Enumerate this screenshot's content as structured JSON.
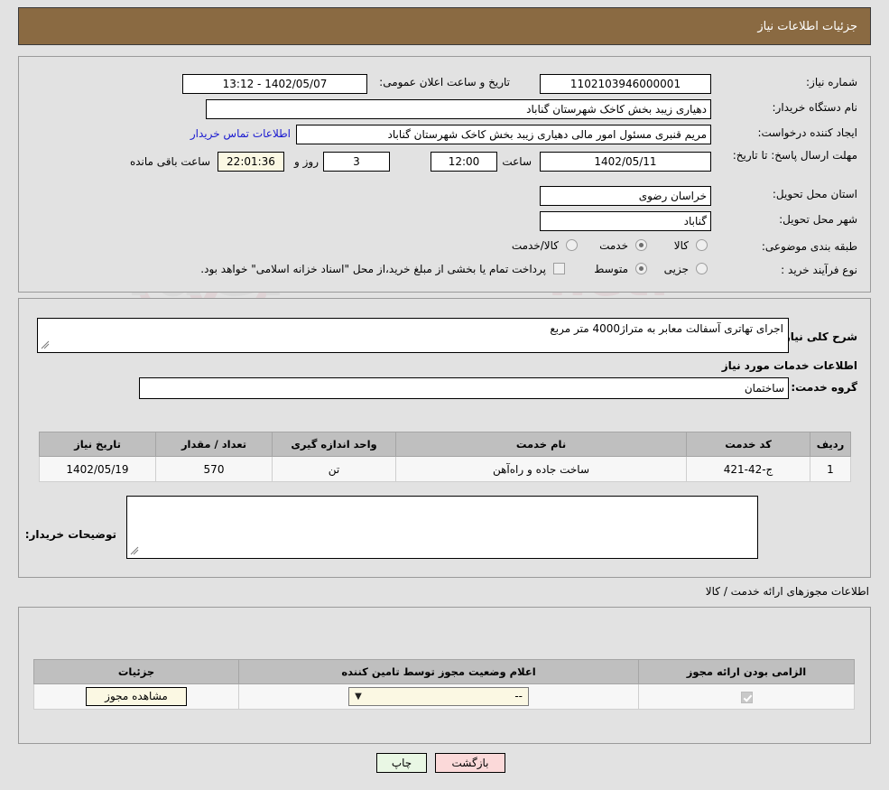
{
  "header": {
    "title": "جزئیات اطلاعات نیاز"
  },
  "watermark": {
    "text": "AnaTender.net"
  },
  "top_form": {
    "need_number": {
      "label": "شماره نیاز:",
      "value": "1102103946000001"
    },
    "public_announce": {
      "label": "تاریخ و ساعت اعلان عمومی:",
      "value": "1402/05/07 - 13:12"
    },
    "buyer_org": {
      "label": "نام دستگاه خریدار:",
      "value": "دهیاری زیبد بخش کاخک شهرستان گناباد"
    },
    "requester": {
      "label": "ایجاد کننده درخواست:",
      "value": "مریم قنبری مسئول امور مالی دهیاری زیبد بخش کاخک شهرستان گناباد"
    },
    "buyer_contact_link": "اطلاعات تماس خریدار",
    "deadline": {
      "label": "مهلت ارسال پاسخ: تا تاریخ:",
      "date": "1402/05/11",
      "time_label": "ساعت",
      "time": "12:00",
      "days": "3",
      "days_label": "روز و",
      "countdown": "22:01:36",
      "remaining_label": "ساعت باقی مانده"
    },
    "province": {
      "label": "استان محل تحویل:",
      "value": "خراسان رضوی"
    },
    "city": {
      "label": "شهر محل تحویل:",
      "value": "گناباد"
    },
    "category": {
      "label": "طبقه بندی موضوعی:",
      "options": [
        "کالا",
        "خدمت",
        "کالا/خدمت"
      ],
      "selected": "خدمت"
    },
    "purchase_type": {
      "label": "نوع فرآیند خرید :",
      "options": [
        "جزیی",
        "متوسط"
      ],
      "selected": "متوسط"
    },
    "treasury_note": {
      "text": "پرداخت تمام یا بخشی از مبلغ خرید،از محل \"اسناد خزانه اسلامی\" خواهد بود.",
      "checked": false
    }
  },
  "mid_section": {
    "need_desc": {
      "label": "شرح کلی نیاز:",
      "value": "اجرای تهاتری آسفالت معابر به متراژ4000 متر مربع"
    },
    "services_caption": "اطلاعات خدمات مورد نیاز",
    "service_group": {
      "label": "گروه خدمت:",
      "value": "ساختمان"
    },
    "items_table": {
      "headers": [
        "ردیف",
        "کد خدمت",
        "نام خدمت",
        "واحد اندازه گیری",
        "تعداد / مقدار",
        "تاریخ نیاز"
      ],
      "rows": [
        {
          "row": "1",
          "code": "ج-42-421",
          "name": "ساخت جاده و راه‌آهن",
          "unit": "تن",
          "qty": "570",
          "date": "1402/05/19"
        }
      ]
    },
    "buyer_notes": {
      "label": "توضیحات خریدار:",
      "value": ""
    }
  },
  "permits": {
    "caption": "اطلاعات مجوزهای ارائه خدمت / کالا",
    "headers": [
      "الزامی بودن ارائه مجوز",
      "اعلام وضعیت مجوز توسط تامین کننده",
      "جزئیات"
    ],
    "rows": [
      {
        "required_checked": true,
        "status_value": "--",
        "details_button": "مشاهده مجوز"
      }
    ]
  },
  "footer": {
    "print_label": "چاپ",
    "back_label": "بازگشت"
  },
  "colors": {
    "header_bg": "#8a6a42",
    "page_bg": "#e2e2e2",
    "link": "#1a1ad0",
    "countdown_bg": "#fbf8e3",
    "back_btn_bg": "#fbd9d9",
    "print_btn_bg": "#e9f7e4",
    "table_header_bg": "#bfbfbf"
  }
}
